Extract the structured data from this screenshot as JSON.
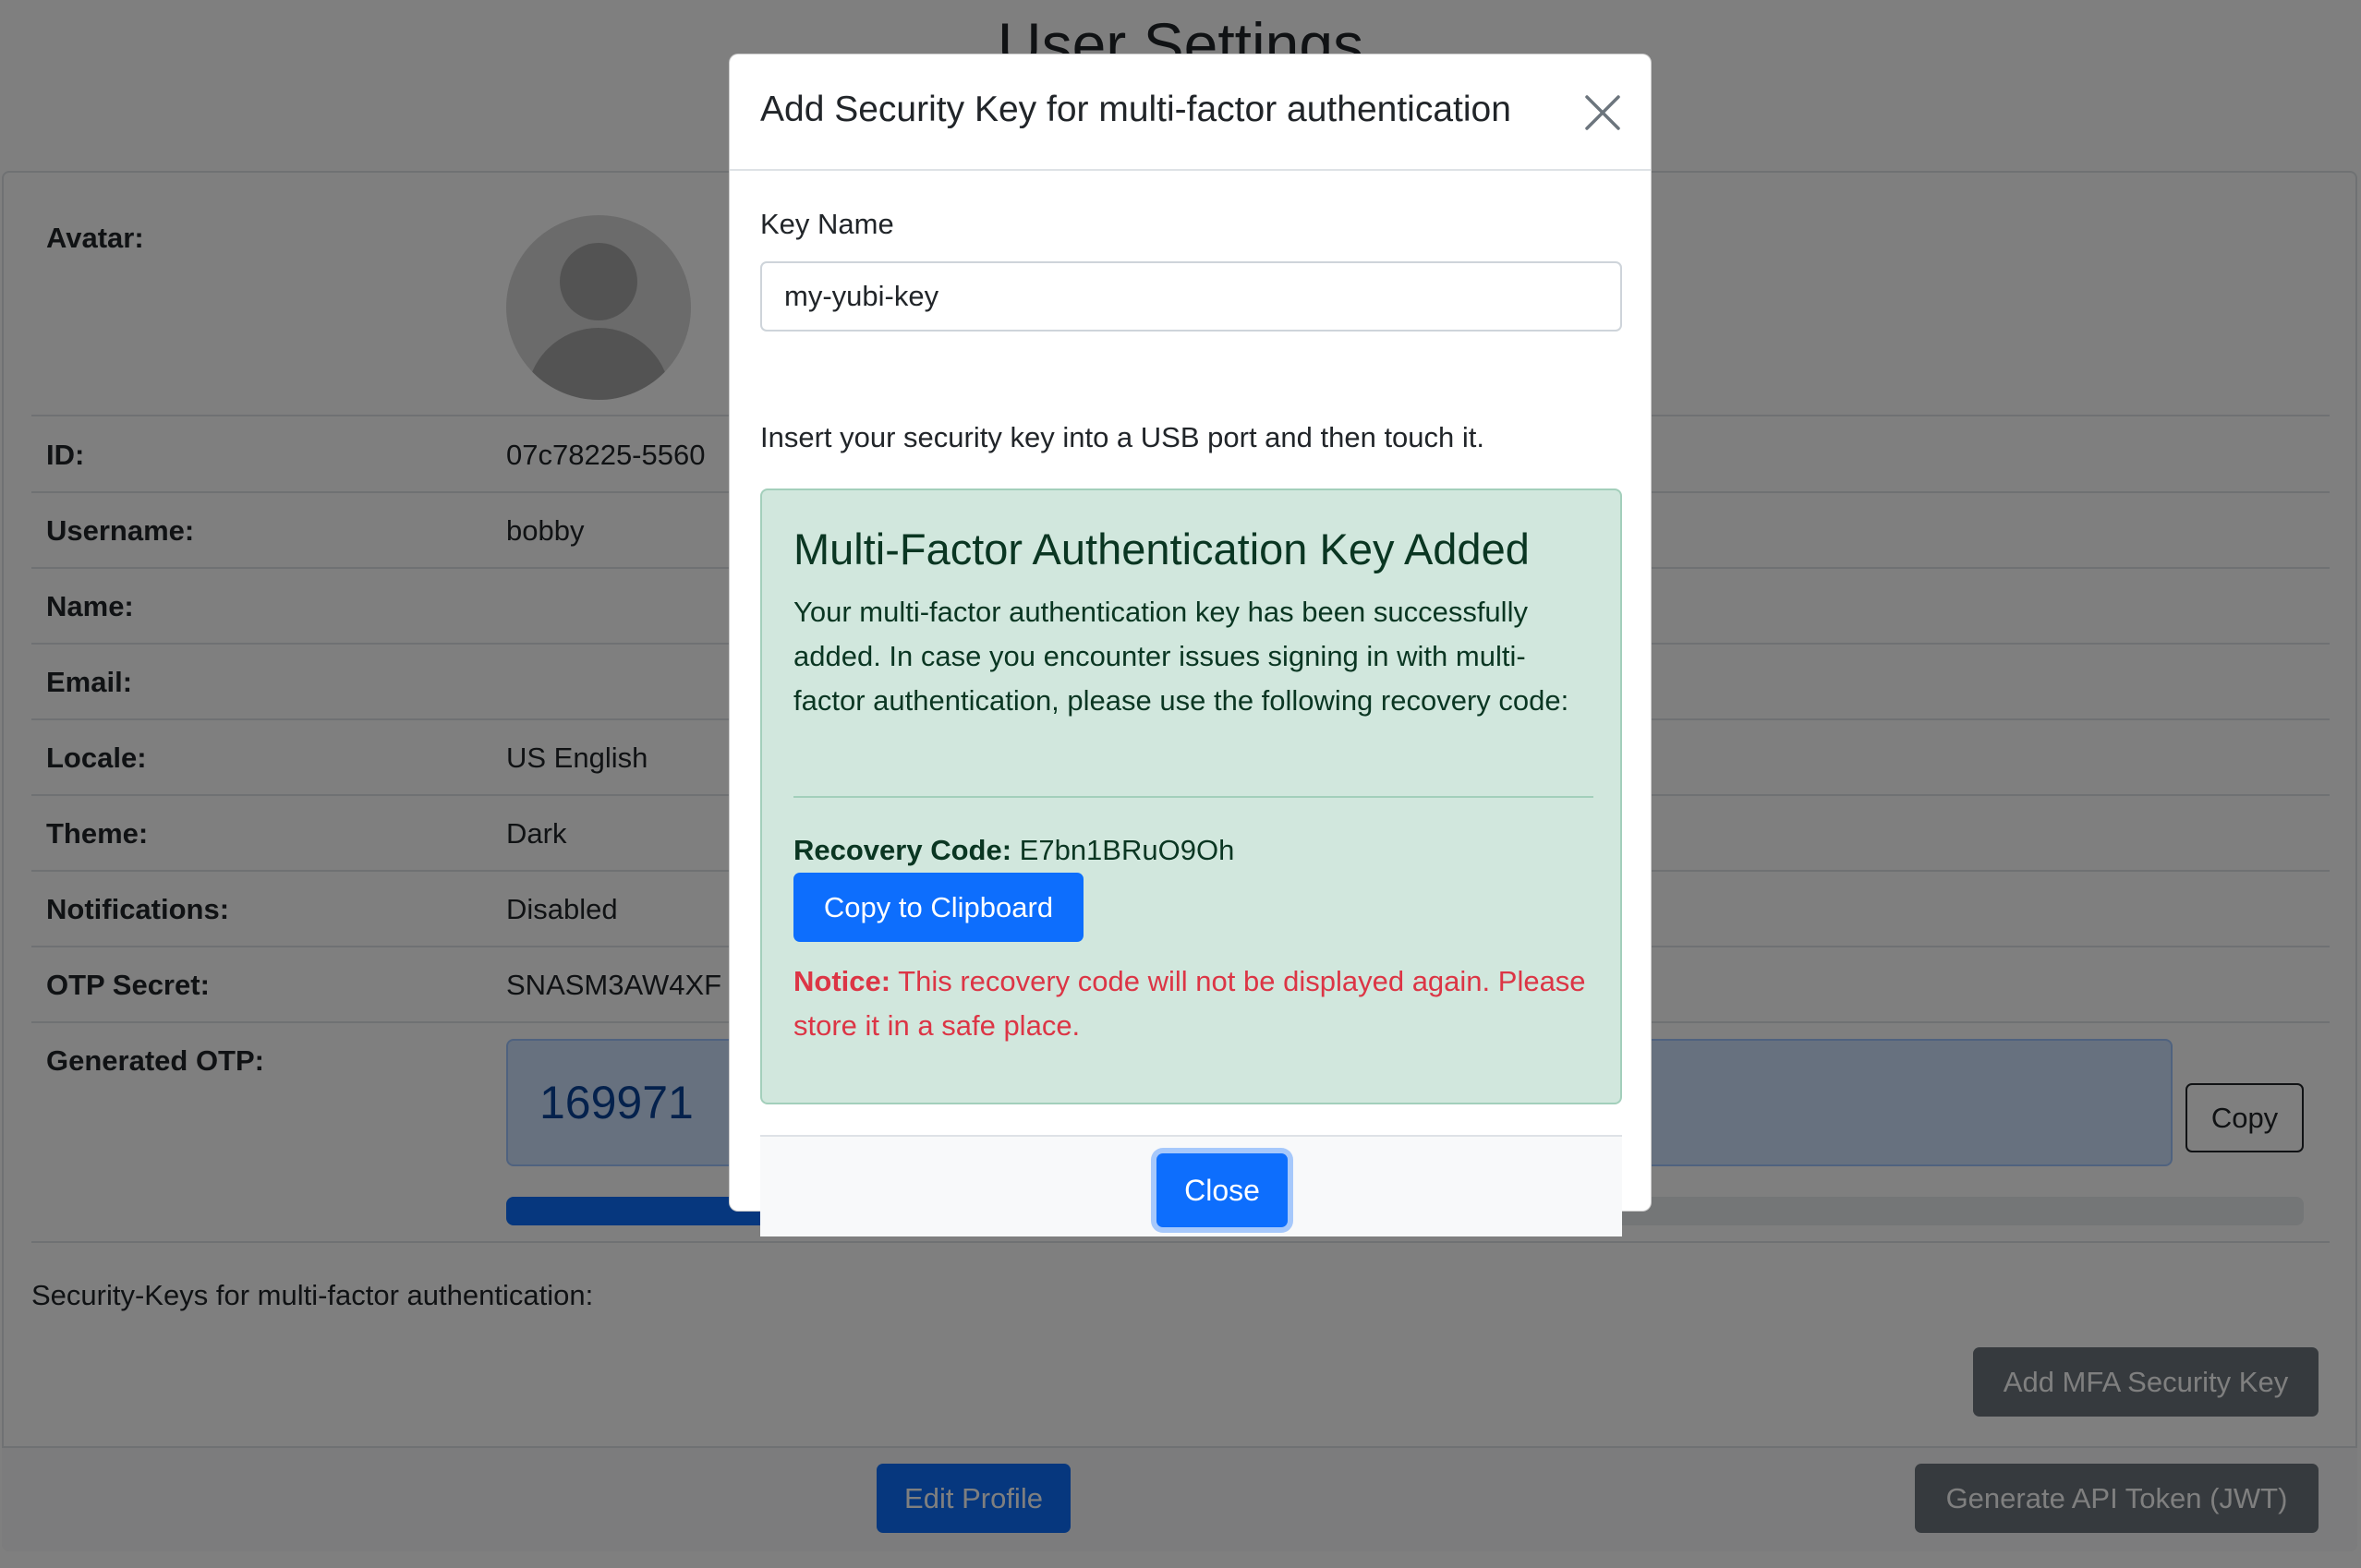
{
  "page": {
    "title": "User Settings",
    "fields": [
      {
        "label": "Avatar:",
        "value": ""
      },
      {
        "label": "ID:",
        "value": "07c78225-5560"
      },
      {
        "label": "Username:",
        "value": "bobby"
      },
      {
        "label": "Name:",
        "value": ""
      },
      {
        "label": "Email:",
        "value": ""
      },
      {
        "label": "Locale:",
        "value": "US English"
      },
      {
        "label": "Theme:",
        "value": "Dark"
      },
      {
        "label": "Notifications:",
        "value": "Disabled"
      },
      {
        "label": "OTP Secret:",
        "value": "SNASM3AW4XF"
      },
      {
        "label": "Generated OTP:",
        "value": "169971"
      }
    ],
    "otp_copy_label": "Copy",
    "otp_progress_percent": 56.5,
    "mfa_section_label": "Security-Keys for multi-factor authentication:",
    "add_mfa_label": "Add MFA Security Key",
    "edit_profile_label": "Edit Profile",
    "generate_token_label": "Generate API Token (JWT)"
  },
  "modal": {
    "title": "Add Security Key for multi-factor authentication",
    "key_name_label": "Key Name",
    "key_name_value": "my-yubi-key",
    "instruction": "Insert your security key into a USB port and then touch it.",
    "alert": {
      "heading": "Multi-Factor Authentication Key Added",
      "text": "Your multi-factor authentication key has been successfully added. In case you encounter issues signing in with multi-factor authentication, please use the following recovery code:",
      "recovery_label": "Recovery Code:",
      "recovery_code": "E7bn1BRuO9Oh",
      "copy_label": "Copy to Clipboard",
      "notice_label": "Notice:",
      "notice_text": "This recovery code will not be displayed again. Please store it in a safe place."
    },
    "close_label": "Close"
  },
  "colors": {
    "primary": "#0d6efd",
    "secondary": "#6c757d",
    "success_bg": "#d1e7dd",
    "danger": "#dc3545"
  }
}
